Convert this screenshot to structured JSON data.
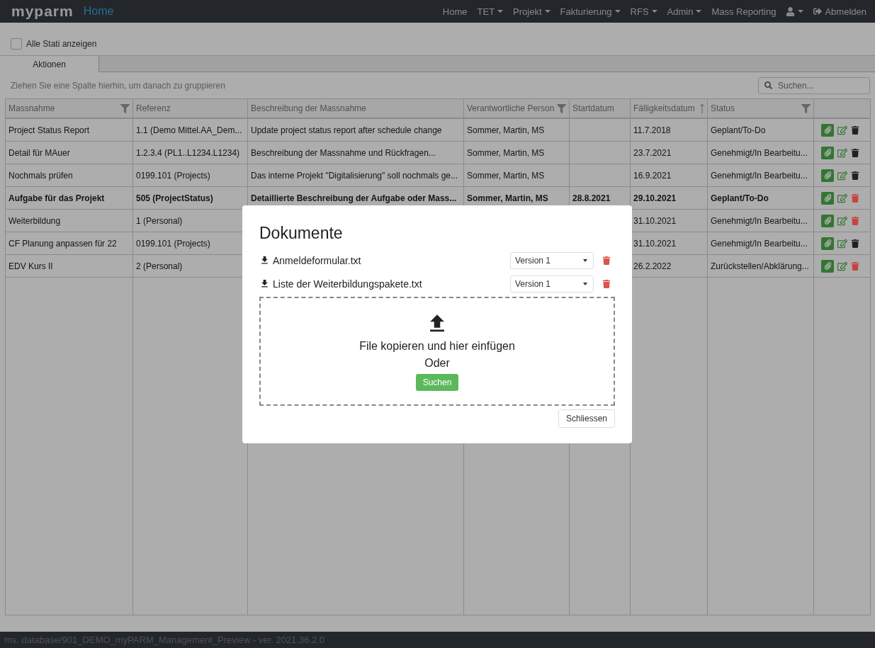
{
  "navbar": {
    "logo": "myparm",
    "page_title": "Home",
    "items": [
      {
        "kind": "link",
        "label": "Home",
        "dropdown": false
      },
      {
        "kind": "link",
        "label": "TET",
        "dropdown": true
      },
      {
        "kind": "link",
        "label": "Projekt",
        "dropdown": true
      },
      {
        "kind": "link",
        "label": "Fakturierung",
        "dropdown": true
      },
      {
        "kind": "link",
        "label": "RFS",
        "dropdown": true
      },
      {
        "kind": "link",
        "label": "Admin",
        "dropdown": true
      },
      {
        "kind": "link",
        "label": "Mass Reporting",
        "dropdown": false
      },
      {
        "kind": "user",
        "dropdown": true
      },
      {
        "kind": "logout",
        "label": "Abmelden",
        "dropdown": false
      }
    ]
  },
  "show_all_status": {
    "label": "Alle Stati anzeigen",
    "checked": false
  },
  "tabs": [
    {
      "label": "Aktionen",
      "selected": true
    }
  ],
  "group_hint": "Ziehen Sie eine Spalte hierhin, um danach zu gruppieren",
  "search": {
    "placeholder": "Suchen..."
  },
  "table": {
    "columns": [
      {
        "label": "Massnahme",
        "filter_icon": true,
        "sorted": false
      },
      {
        "label": "Referenz",
        "filter_icon": false,
        "sorted": false
      },
      {
        "label": "Beschreibung der Massnahme",
        "filter_icon": false,
        "sorted": false
      },
      {
        "label": "Verantwortliche Person",
        "filter_icon": true,
        "sorted": false
      },
      {
        "label": "Startdatum",
        "filter_icon": false,
        "sorted": false
      },
      {
        "label": "Fälligkeitsdatum",
        "filter_icon": false,
        "sorted": true
      },
      {
        "label": "Status",
        "filter_icon": true,
        "sorted": false
      }
    ],
    "rows": [
      {
        "emphasized": false,
        "cells": [
          "Project Status Report",
          "1.1 (Demo Mittel.AA_Dem...",
          "Update project status report after schedule change",
          "Sommer, Martin, MS",
          null,
          "11.7.2018",
          "Geplant/To-Do"
        ],
        "color": "#212121"
      },
      {
        "emphasized": false,
        "cells": [
          "Detail für MAuer",
          "1.2.3.4 (PL1..L1234.L1234)",
          "Beschreibung der Massnahme und Rückfragen...",
          "Sommer, Martin, MS",
          null,
          "23.7.2021",
          "Genehmigt/In Bearbeitu..."
        ],
        "color": "#212121"
      },
      {
        "emphasized": false,
        "cells": [
          "Nochmals prüfen",
          "0199.101 (Projects)",
          "Das interne Projekt \"Digitalisierung\" soll nochmals ge...",
          "Sommer, Martin, MS",
          null,
          "16.9.2021",
          "Genehmigt/In Bearbeitu..."
        ],
        "color": "#212121"
      },
      {
        "emphasized": true,
        "cells": [
          "Aufgabe für das Projekt",
          "505 (ProjectStatus)",
          "Detaillierte Beschreibung der Aufgabe oder Mass...",
          "Sommer, Martin, MS",
          "28.8.2021",
          "29.10.2021",
          "Geplant/To-Do"
        ],
        "color": "#c9443f"
      },
      {
        "emphasized": false,
        "cells": [
          "Weiterbildung",
          "1 (Personal)",
          null,
          null,
          null,
          "31.10.2021",
          "Genehmigt/In Bearbeitu..."
        ],
        "color": "#c9443f"
      },
      {
        "emphasized": false,
        "cells": [
          "CF Planung anpassen für 22",
          "0199.101 (Projects)",
          null,
          null,
          null,
          "31.10.2021",
          "Genehmigt/In Bearbeitu..."
        ],
        "color": "#212121"
      },
      {
        "emphasized": false,
        "cells": [
          "EDV Kurs II",
          "2 (Personal)",
          null,
          null,
          null,
          "26.2.2022",
          "Zurückstellen/Abklärung..."
        ],
        "color": "#c9443f"
      }
    ]
  },
  "modal": {
    "title": "Dokumente",
    "documents": [
      {
        "name": "Anmeldeformular.txt",
        "version": "Version 1"
      },
      {
        "name": "Liste der Weiterbildungspakete.txt",
        "version": "Version 1"
      }
    ],
    "dropzone": {
      "text": "File kopieren und hier einfügen",
      "or": "Oder",
      "button": "Suchen"
    },
    "close_button": "Schliessen"
  },
  "footer": "ms. database/901_DEMO_myPARM_Management_Preview - ver. 2021.36.2.0"
}
